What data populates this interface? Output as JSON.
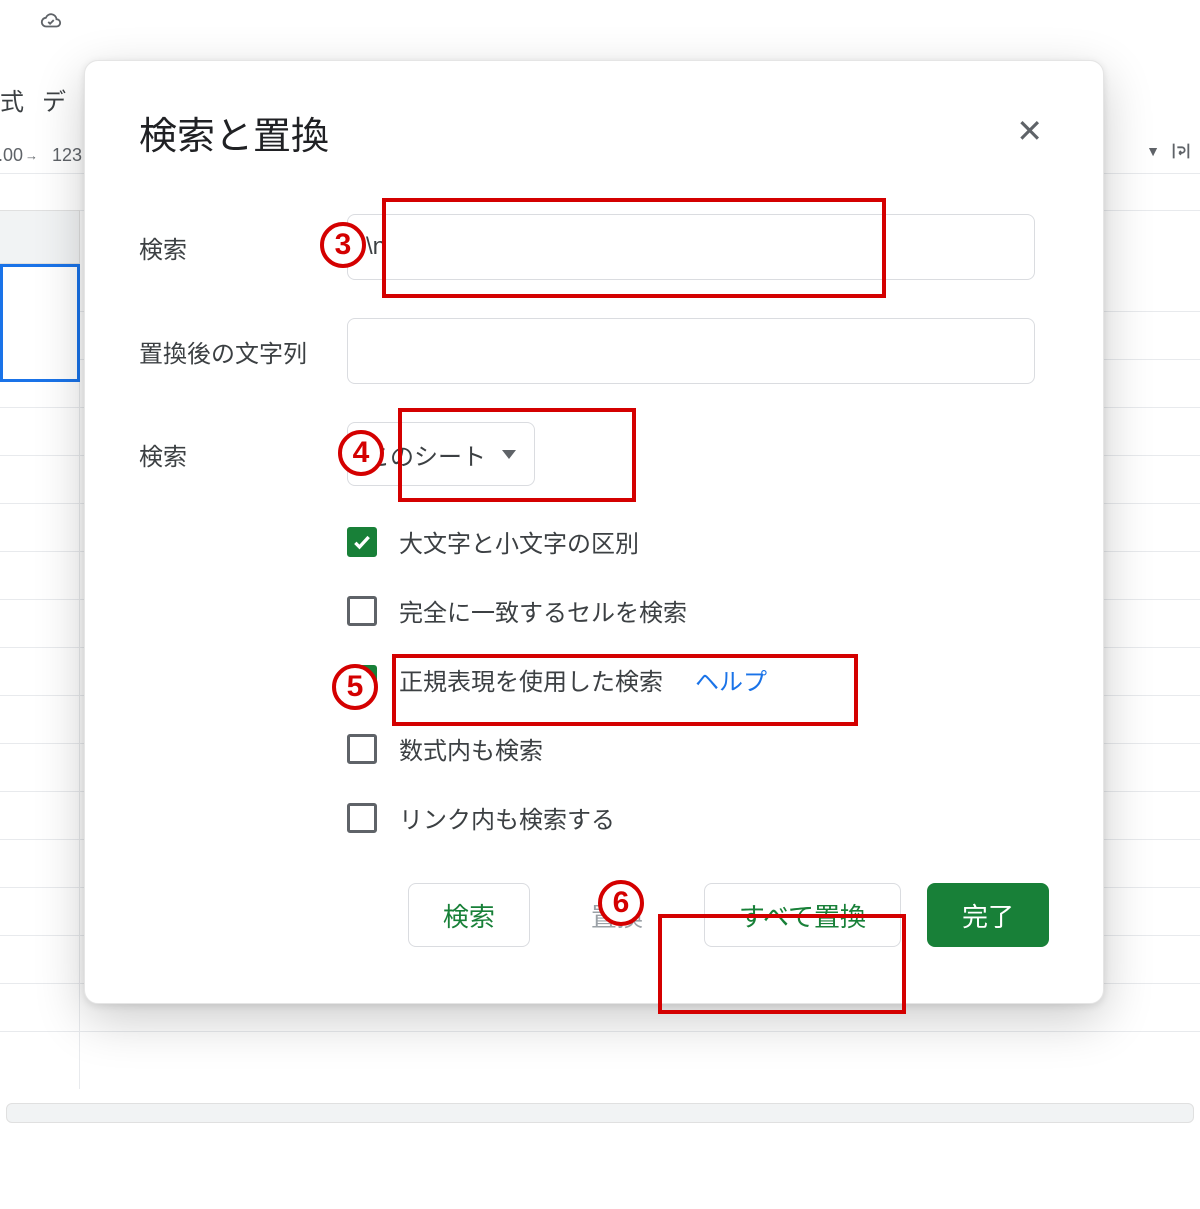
{
  "menubar": {
    "frag1": "式",
    "frag2": "デ"
  },
  "toolbar": {
    "decimals": ".00",
    "more": "123"
  },
  "dialog": {
    "title": "検索と置換",
    "search_label": "検索",
    "search_value": "\\n",
    "replace_label": "置換後の文字列",
    "replace_value": "",
    "scope_label": "検索",
    "scope_value": "このシート",
    "options": {
      "match_case": {
        "label": "大文字と小文字の区別",
        "checked": true
      },
      "entire_cell": {
        "label": "完全に一致するセルを検索",
        "checked": false
      },
      "regex": {
        "label": "正規表現を使用した検索",
        "checked": true,
        "help": "ヘルプ"
      },
      "in_formulas": {
        "label": "数式内も検索",
        "checked": false
      },
      "in_links": {
        "label": "リンク内も検索する",
        "checked": false
      }
    },
    "buttons": {
      "find": "検索",
      "replace": "置換",
      "replace_all": "すべて置換",
      "done": "完了"
    }
  },
  "annotations": {
    "n3": "3",
    "n4": "4",
    "n5": "5",
    "n6": "6"
  }
}
